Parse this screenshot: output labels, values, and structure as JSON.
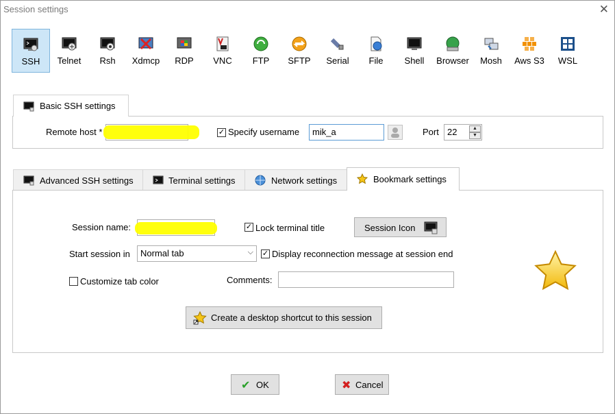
{
  "window": {
    "title": "Session settings",
    "close_glyph": "✕"
  },
  "protocols": [
    {
      "label": "SSH",
      "icon": "ssh-icon",
      "selected": true
    },
    {
      "label": "Telnet",
      "icon": "telnet-icon"
    },
    {
      "label": "Rsh",
      "icon": "rsh-icon"
    },
    {
      "label": "Xdmcp",
      "icon": "xdmcp-icon"
    },
    {
      "label": "RDP",
      "icon": "rdp-icon"
    },
    {
      "label": "VNC",
      "icon": "vnc-icon"
    },
    {
      "label": "FTP",
      "icon": "ftp-icon"
    },
    {
      "label": "SFTP",
      "icon": "sftp-icon"
    },
    {
      "label": "Serial",
      "icon": "serial-icon"
    },
    {
      "label": "File",
      "icon": "file-icon"
    },
    {
      "label": "Shell",
      "icon": "shell-icon"
    },
    {
      "label": "Browser",
      "icon": "browser-icon"
    },
    {
      "label": "Mosh",
      "icon": "mosh-icon"
    },
    {
      "label": "Aws S3",
      "icon": "aws-s3-icon"
    },
    {
      "label": "WSL",
      "icon": "wsl-icon"
    }
  ],
  "basic": {
    "tab_label": "Basic SSH settings",
    "remote_host_label": "Remote host *",
    "remote_host_value": "",
    "specify_username_label": "Specify username",
    "specify_username_checked": true,
    "username_value": "mik_a",
    "port_label": "Port",
    "port_value": "22"
  },
  "tabs": [
    {
      "label": "Advanced SSH settings",
      "icon": "terminal-icon"
    },
    {
      "label": "Terminal settings",
      "icon": "terminal-settings-icon"
    },
    {
      "label": "Network settings",
      "icon": "network-icon"
    },
    {
      "label": "Bookmark settings",
      "icon": "star-icon",
      "active": true
    }
  ],
  "bookmark": {
    "session_name_label": "Session name:",
    "session_name_value": "",
    "lock_title_label": "Lock terminal title",
    "lock_title_checked": true,
    "session_icon_button": "Session Icon",
    "start_session_label": "Start session in",
    "start_session_value": "Normal tab",
    "display_reconnect_label": "Display reconnection message at session end",
    "display_reconnect_checked": true,
    "customize_tab_color_label": "Customize tab color",
    "customize_tab_color_checked": false,
    "comments_label": "Comments:",
    "comments_value": "",
    "shortcut_button": "Create a desktop shortcut to this session"
  },
  "footer": {
    "ok_label": "OK",
    "cancel_label": "Cancel"
  },
  "colors": {
    "accent": "#cde6f7",
    "highlight": "#ffff00",
    "star": "#f5c518"
  }
}
